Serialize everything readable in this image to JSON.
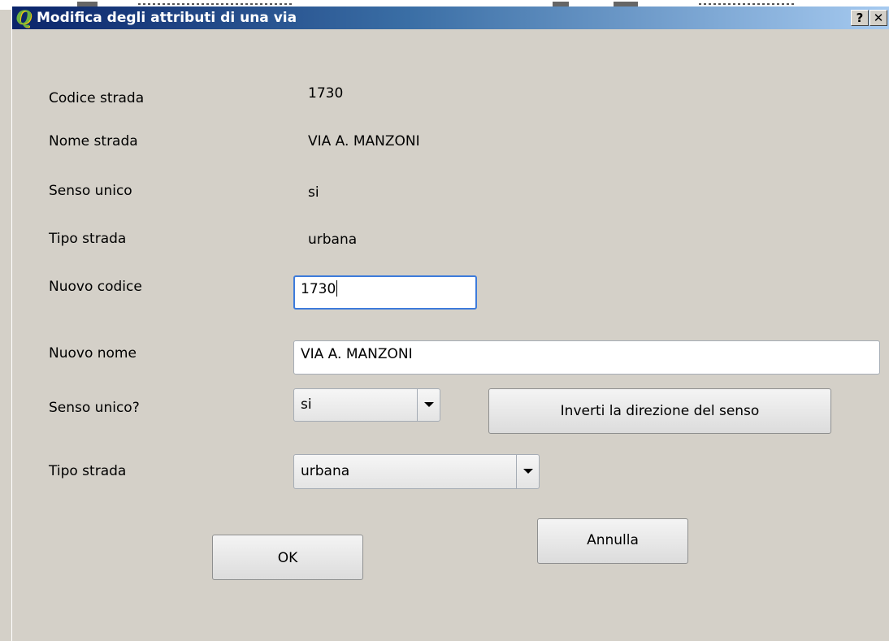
{
  "dialog": {
    "title": "Modifica degli attributi di una via",
    "app_icon_glyph": "Q",
    "help_label": "?",
    "close_label": "✕"
  },
  "info": [
    {
      "label": "Codice strada",
      "value": "1730"
    },
    {
      "label": "Nome strada",
      "value": "VIA A. MANZONI"
    },
    {
      "label": "Senso unico",
      "value": "si"
    },
    {
      "label": "Tipo strada",
      "value": "urbana"
    }
  ],
  "form": {
    "nuovo_codice": {
      "label": "Nuovo codice",
      "value": "1730"
    },
    "nuovo_nome": {
      "label": "Nuovo nome",
      "value": "VIA A. MANZONI"
    },
    "senso_unico": {
      "label": "Senso unico?",
      "selected": "si"
    },
    "tipo_strada": {
      "label": "Tipo strada",
      "selected": "urbana"
    }
  },
  "buttons": {
    "invert": "Inverti la direzione del senso",
    "ok": "OK",
    "cancel": "Annulla"
  },
  "colors": {
    "titlebar_start": "#0a246a",
    "titlebar_end": "#a6caf0",
    "window_bg": "#d4d0c8",
    "focus_border": "#3d7bdb"
  }
}
